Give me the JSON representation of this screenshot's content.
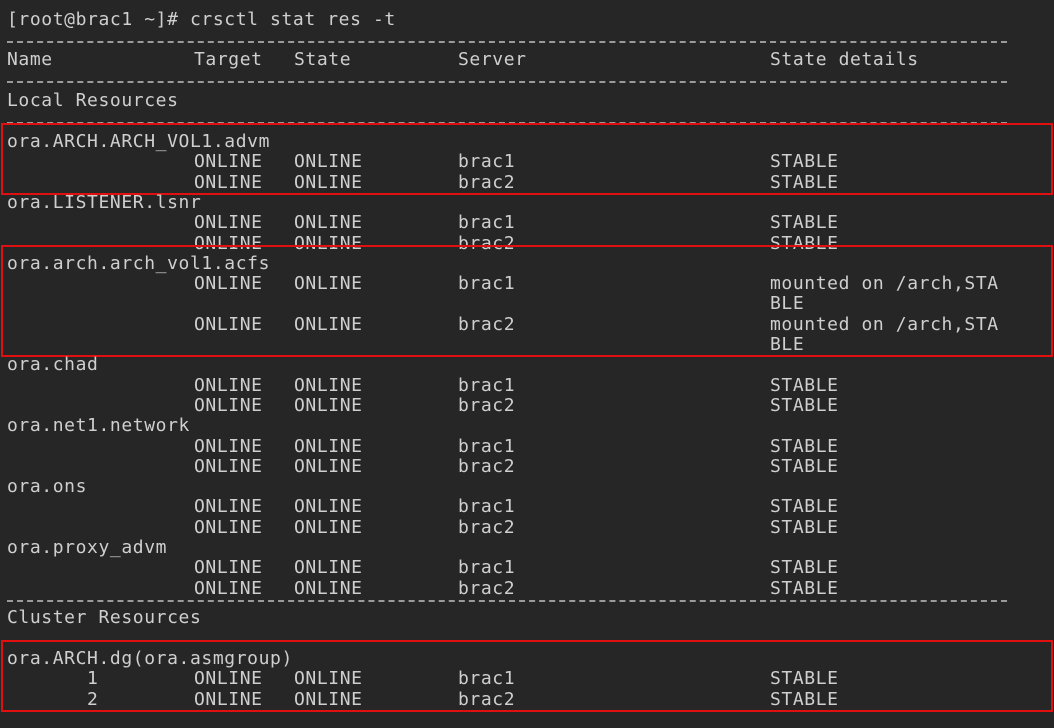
{
  "prompt": "[root@brac1 ~]# crsctl stat res -t",
  "header": {
    "name": "Name",
    "target": "Target",
    "state": "State",
    "server": "Server",
    "details": "State details"
  },
  "local_section": "Local Resources",
  "cluster_section": "Cluster Resources",
  "highlight_color": "#e01010",
  "local_resources": [
    {
      "name": "ora.ARCH.ARCH_VOL1.advm",
      "highlighted": true,
      "rows": [
        {
          "target": "ONLINE",
          "state": "ONLINE",
          "server": "brac1",
          "details": "STABLE"
        },
        {
          "target": "ONLINE",
          "state": "ONLINE",
          "server": "brac2",
          "details": "STABLE"
        }
      ]
    },
    {
      "name": "ora.LISTENER.lsnr",
      "highlighted": false,
      "rows": [
        {
          "target": "ONLINE",
          "state": "ONLINE",
          "server": "brac1",
          "details": "STABLE"
        },
        {
          "target": "ONLINE",
          "state": "ONLINE",
          "server": "brac2",
          "details": "STABLE"
        }
      ]
    },
    {
      "name": "ora.arch.arch_vol1.acfs",
      "highlighted": true,
      "rows": [
        {
          "target": "ONLINE",
          "state": "ONLINE",
          "server": "brac1",
          "details": "mounted on /arch,STA",
          "details_cont": "BLE"
        },
        {
          "target": "ONLINE",
          "state": "ONLINE",
          "server": "brac2",
          "details": "mounted on /arch,STA",
          "details_cont": "BLE"
        }
      ]
    },
    {
      "name": "ora.chad",
      "highlighted": false,
      "rows": [
        {
          "target": "ONLINE",
          "state": "ONLINE",
          "server": "brac1",
          "details": "STABLE"
        },
        {
          "target": "ONLINE",
          "state": "ONLINE",
          "server": "brac2",
          "details": "STABLE"
        }
      ]
    },
    {
      "name": "ora.net1.network",
      "highlighted": false,
      "rows": [
        {
          "target": "ONLINE",
          "state": "ONLINE",
          "server": "brac1",
          "details": "STABLE"
        },
        {
          "target": "ONLINE",
          "state": "ONLINE",
          "server": "brac2",
          "details": "STABLE"
        }
      ]
    },
    {
      "name": "ora.ons",
      "highlighted": false,
      "rows": [
        {
          "target": "ONLINE",
          "state": "ONLINE",
          "server": "brac1",
          "details": "STABLE"
        },
        {
          "target": "ONLINE",
          "state": "ONLINE",
          "server": "brac2",
          "details": "STABLE"
        }
      ]
    },
    {
      "name": "ora.proxy_advm",
      "highlighted": false,
      "rows": [
        {
          "target": "ONLINE",
          "state": "ONLINE",
          "server": "brac1",
          "details": "STABLE"
        },
        {
          "target": "ONLINE",
          "state": "ONLINE",
          "server": "brac2",
          "details": "STABLE"
        }
      ]
    }
  ],
  "cluster_resources": [
    {
      "name": "ora.ARCH.dg(ora.asmgroup)",
      "highlighted": true,
      "rows": [
        {
          "index": "1",
          "target": "ONLINE",
          "state": "ONLINE",
          "server": "brac1",
          "details": "STABLE"
        },
        {
          "index": "2",
          "target": "ONLINE",
          "state": "ONLINE",
          "server": "brac2",
          "details": "STABLE"
        }
      ]
    }
  ]
}
